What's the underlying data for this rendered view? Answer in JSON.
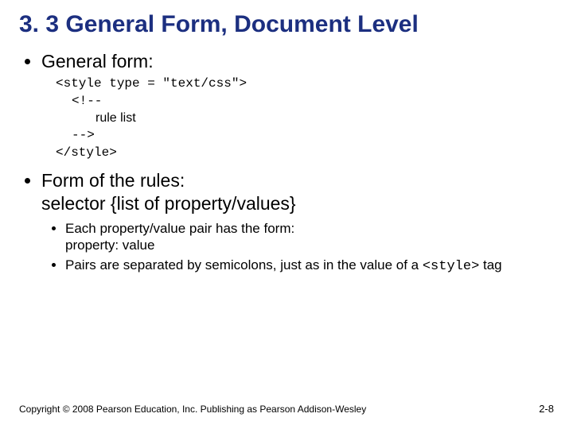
{
  "title": "3. 3 General Form, Document Level",
  "bullets": {
    "b1": "General form:",
    "code": {
      "l1": "<style type = \"text/css\">",
      "l2": "<!--",
      "l3": "rule list",
      "l4": "-->",
      "l5": "</style>"
    },
    "b2_line1": "Form of the rules:",
    "b2_line2": "selector {list of property/values}",
    "sub": {
      "s1_line1": "Each property/value pair has the form:",
      "s1_line2": "property: value",
      "s2_pre": "Pairs are separated by semicolons, just as in the value of a ",
      "s2_code": "<style>",
      "s2_post": " tag"
    }
  },
  "footer": {
    "copyright": "Copyright © 2008 Pearson Education, Inc. Publishing as Pearson Addison-Wesley",
    "page": "2-8"
  }
}
